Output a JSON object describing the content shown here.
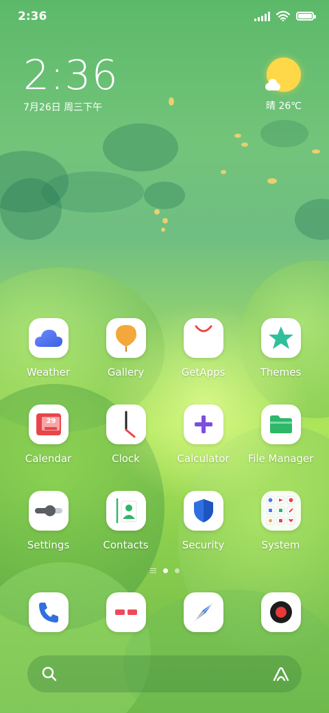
{
  "status_bar": {
    "time": "2:36",
    "icons": [
      "cellular-signal-icon",
      "wifi-icon",
      "battery-icon"
    ],
    "battery_level": 1.0
  },
  "clock_widget": {
    "time": "2:36",
    "date": "7月26日 周三下午"
  },
  "weather_widget": {
    "icon": "sun-cloud-icon",
    "text": "晴 26℃"
  },
  "apps": [
    {
      "label": "Weather",
      "icon": "weather-cloud-icon"
    },
    {
      "label": "Gallery",
      "icon": "gallery-balloon-icon"
    },
    {
      "label": "GetApps",
      "icon": "getapps-bag-icon"
    },
    {
      "label": "Themes",
      "icon": "themes-star-icon"
    },
    {
      "label": "Calendar",
      "icon": "calendar-icon",
      "badge": "29"
    },
    {
      "label": "Clock",
      "icon": "clock-icon"
    },
    {
      "label": "Calculator",
      "icon": "calculator-plus-icon"
    },
    {
      "label": "File Manager",
      "icon": "folder-icon"
    },
    {
      "label": "Settings",
      "icon": "settings-toggle-icon"
    },
    {
      "label": "Contacts",
      "icon": "contacts-icon"
    },
    {
      "label": "Security",
      "icon": "shield-icon"
    },
    {
      "label": "System",
      "icon": "folder-grid-icon"
    }
  ],
  "page_indicator": {
    "pages": 2,
    "current": 1
  },
  "dock": [
    {
      "icon": "phone-icon"
    },
    {
      "icon": "messages-icon"
    },
    {
      "icon": "browser-compass-icon"
    },
    {
      "icon": "camera-icon"
    }
  ],
  "search_bar": {
    "left_icon": "search-icon",
    "right_icon": "assistant-a-icon"
  },
  "colors": {
    "weather_blue": "#4f7bef",
    "gallery_orange": "#f4a73a",
    "getapps_red": "#f0443a",
    "themes_teal": "#2fbf9c",
    "calendar_red": "#e8454a",
    "calculator_purple": "#7b4fe0",
    "folder_green": "#2fb76a",
    "security_blue": "#2f6fe0",
    "phone_blue": "#2f6fe0",
    "messages_red": "#f04a5a",
    "camera_red": "#e83a3a"
  }
}
